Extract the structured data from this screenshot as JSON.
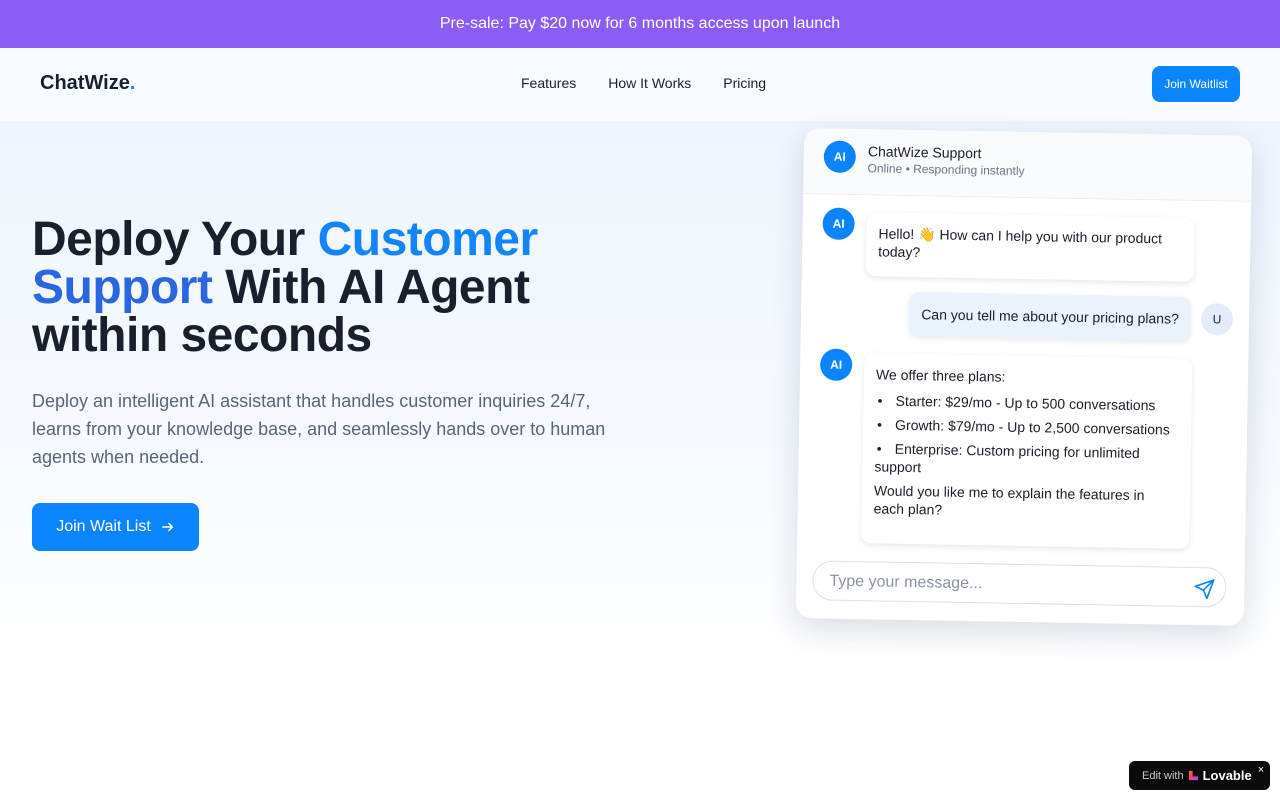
{
  "banner": {
    "text": "Pre-sale: Pay $20 now for 6 months access upon launch"
  },
  "header": {
    "logo_text": "ChatWize",
    "logo_dot": ".",
    "nav": [
      "Features",
      "How It Works",
      "Pricing"
    ],
    "waitlist_label": "Join Waitlist"
  },
  "hero": {
    "headline_1": "Deploy Your ",
    "headline_accent_1": "Customer",
    "headline_accent_2": "Support",
    "headline_2": " With AI Agent within seconds",
    "subtext": "Deploy an intelligent AI assistant that handles customer inquiries 24/7, learns from your knowledge base, and seamlessly hands over to human agents when needed.",
    "cta_label": "Join Wait List"
  },
  "chat": {
    "title": "ChatWize Support",
    "status": "Online • Responding instantly",
    "ai_avatar": "AI",
    "user_avatar": "U",
    "messages": [
      {
        "from": "ai",
        "text": "Hello! 👋 How can I help you with our product today?"
      },
      {
        "from": "user",
        "text": "Can you tell me about your pricing plans?"
      },
      {
        "from": "ai",
        "intro": "We offer three plans:",
        "items": [
          "Starter: $29/mo - Up to 500 conversations",
          "Growth: $79/mo - Up to 2,500 conversations",
          "Enterprise: Custom pricing for unlimited support"
        ],
        "outro": "Would you like me to explain the features in each plan?"
      }
    ],
    "input_placeholder": "Type your message..."
  },
  "badge": {
    "edit_text": "Edit with",
    "brand": "Lovable",
    "close": "×"
  },
  "colors": {
    "banner": "#8b5cf6",
    "accent": "#0a84ff",
    "text": "#1a1f2b",
    "muted": "#5a6577"
  },
  "icons": [
    "arrow-right-icon",
    "send-icon",
    "lovable-heart-icon",
    "close-icon"
  ]
}
